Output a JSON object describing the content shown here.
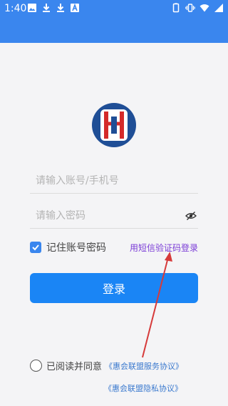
{
  "status_bar": {
    "time": "1:40"
  },
  "form": {
    "account_placeholder": "请输入账号/手机号",
    "password_placeholder": "请输入密码",
    "remember_label": "记住账号密码",
    "remember_checked": true,
    "sms_login_link": "用短信验证码登录",
    "login_button": "登录"
  },
  "agreement": {
    "prefix": "已阅读并同意",
    "service_agreement": "《惠会联盟服务协议》",
    "privacy_agreement": "《惠会联盟隐私协议》"
  },
  "colors": {
    "header": "#3a86ee",
    "button": "#1a85f5",
    "link_purple": "#7a3bd6",
    "link_blue": "#3a79ce",
    "annotation_arrow": "#d63a3a"
  },
  "icons": [
    "image-icon",
    "download-icon",
    "download-icon",
    "a-icon",
    "battery-outline-icon",
    "vibrate-icon",
    "wifi-icon",
    "signal-icon",
    "eye-hidden-icon",
    "check-icon"
  ]
}
